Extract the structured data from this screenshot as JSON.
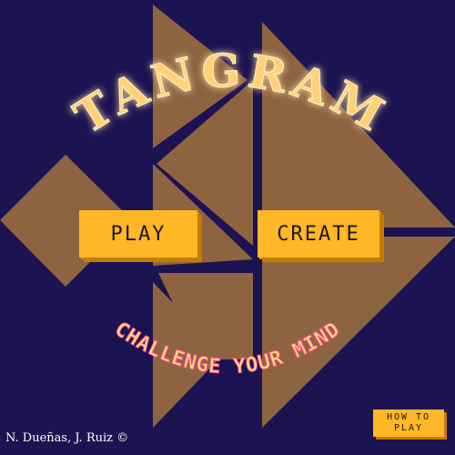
{
  "title": "TANGRAM",
  "buttons": {
    "play": "PLAY",
    "create": "CREATE",
    "howto_line1": "HOW TO",
    "howto_line2": "PLAY"
  },
  "tagline": "CHALLENGE YOUR MIND",
  "credits": "N. Dueñas, J. Ruiz ©",
  "colors": {
    "background": "#1c1352",
    "piece": "#8e6440",
    "accent": "#ffb627",
    "title_glow": "#ffd27a"
  }
}
